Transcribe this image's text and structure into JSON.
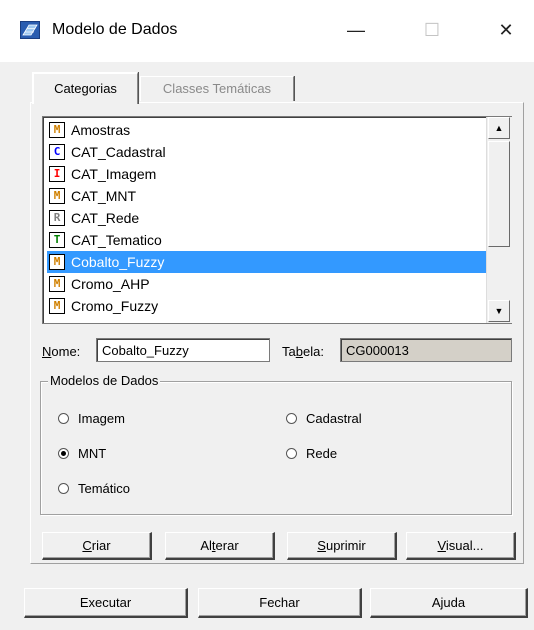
{
  "window": {
    "title": "Modelo de Dados",
    "minimize_glyph": "—",
    "maximize_glyph": "☐",
    "close_glyph": "✕",
    "icon": "layers-icon"
  },
  "tabs": [
    {
      "label": "Categorias",
      "active": true
    },
    {
      "label": "Classes Temáticas",
      "active": false
    }
  ],
  "categories": [
    {
      "icon_letter": "M",
      "icon_color": "#d08000",
      "label": "Amostras",
      "selected": false
    },
    {
      "icon_letter": "C",
      "icon_color": "#0000ff",
      "label": "CAT_Cadastral",
      "selected": false
    },
    {
      "icon_letter": "I",
      "icon_color": "#ff0000",
      "label": "CAT_Imagem",
      "selected": false
    },
    {
      "icon_letter": "M",
      "icon_color": "#d08000",
      "label": "CAT_MNT",
      "selected": false
    },
    {
      "icon_letter": "R",
      "icon_color": "#808080",
      "label": "CAT_Rede",
      "selected": false
    },
    {
      "icon_letter": "T",
      "icon_color": "#008000",
      "label": "CAT_Tematico",
      "selected": false
    },
    {
      "icon_letter": "M",
      "icon_color": "#d08000",
      "label": "Cobalto_Fuzzy",
      "selected": true
    },
    {
      "icon_letter": "M",
      "icon_color": "#d08000",
      "label": "Cromo_AHP",
      "selected": false
    },
    {
      "icon_letter": "M",
      "icon_color": "#d08000",
      "label": "Cromo_Fuzzy",
      "selected": false
    }
  ],
  "nome": {
    "label_prefix": "N",
    "label_rest": "ome:",
    "value": "Cobalto_Fuzzy"
  },
  "tabela": {
    "label_pre": "Ta",
    "label_ul": "b",
    "label_post": "ela:",
    "value": "CG000013"
  },
  "modelos": {
    "legend": "Modelos de Dados",
    "options": [
      {
        "label": "Imagem",
        "checked": false
      },
      {
        "label": "Cadastral",
        "checked": false
      },
      {
        "label": "MNT",
        "checked": true
      },
      {
        "label": "Rede",
        "checked": false
      },
      {
        "label": "Temático",
        "checked": false
      }
    ]
  },
  "actions": {
    "criar": {
      "ul": "C",
      "rest": "riar"
    },
    "alterar": {
      "pre": "Al",
      "ul": "t",
      "rest": "erar"
    },
    "suprimir": {
      "ul": "S",
      "rest": "uprimir"
    },
    "visual": {
      "ul": "V",
      "rest": "isual..."
    }
  },
  "footer": {
    "executar": "Executar",
    "fechar": "Fechar",
    "ajuda": "Ajuda"
  },
  "colors": {
    "selection": "#3399ff",
    "readonly_field": "#d4d0c8"
  }
}
